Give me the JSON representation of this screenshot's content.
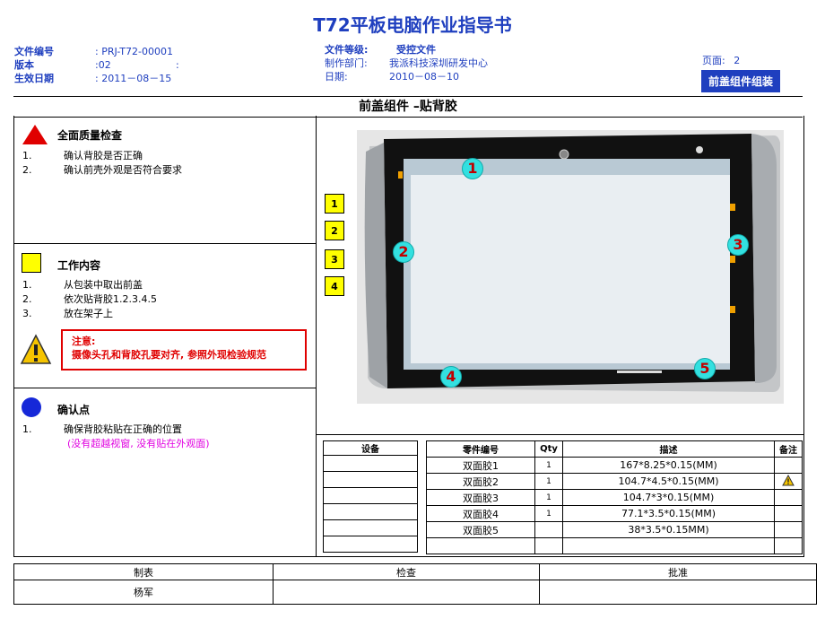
{
  "title": "T72平板电脑作业指导书",
  "header_left": {
    "doc_no_label": "文件编号",
    "doc_no_value": ": PRJ-T72-00001",
    "version_label": "版本",
    "version_value": ":02",
    "colon_extra": ":",
    "effective_label": "生效日期",
    "effective_value": ": 2011－08－15"
  },
  "header_mid": {
    "level_label": "文件等级:",
    "level_value": "受控文件",
    "dept_label": "制作部门:",
    "dept_value": "我派科技深圳研发中心",
    "date_label": "日期:",
    "date_value": "2010－08－10"
  },
  "header_right": {
    "page_label": "页面:",
    "page_value": "2",
    "section_badge": "前盖组件组装"
  },
  "section_title": "前盖组件 –贴背胶",
  "quality": {
    "title": "全面质量检查",
    "items": [
      {
        "num": "1.",
        "text": "确认背胶是否正确"
      },
      {
        "num": "2.",
        "text": "确认前壳外观是否符合要求"
      }
    ]
  },
  "work": {
    "title": "工作内容",
    "items": [
      {
        "num": "1.",
        "text": "从包装中取出前盖"
      },
      {
        "num": "2.",
        "text": "依次贴背胶1.2.3.4.5"
      },
      {
        "num": "3.",
        "text": "放在架子上"
      }
    ],
    "notice_title": "注意:",
    "notice_text": "摄像头孔和背胶孔要对齐, 参照外现检验规范"
  },
  "confirm": {
    "title": "确认点",
    "item_num": "1.",
    "item_text": "确保背胶粘贴在正确的位置",
    "sub_text": "(没有超越视窗, 没有贴在外观面)"
  },
  "step_boxes": [
    "1",
    "2",
    "3",
    "4"
  ],
  "callouts": [
    "1",
    "2",
    "3",
    "4",
    "5"
  ],
  "equipment_header": "设备",
  "parts": {
    "headers": [
      "零件编号",
      "Qty",
      "描述",
      "备注"
    ],
    "rows": [
      {
        "part": "双面胶1",
        "qty": "1",
        "desc": "167*8.25*0.15(MM)",
        "note": ""
      },
      {
        "part": "双面胶2",
        "qty": "1",
        "desc": "104.7*4.5*0.15(MM)",
        "note": "warning-icon"
      },
      {
        "part": "双面胶3",
        "qty": "1",
        "desc": "104.7*3*0.15(MM)",
        "note": ""
      },
      {
        "part": "双面胶4",
        "qty": "1",
        "desc": "77.1*3.5*0.15(MM)",
        "note": ""
      },
      {
        "part": "双面胶5",
        "qty": "",
        "desc": "38*3.5*0.15MM)",
        "note": ""
      }
    ]
  },
  "signoff": {
    "made_label": "制表",
    "check_label": "检查",
    "approve_label": "批准",
    "made_by": "杨军"
  },
  "colors": {
    "accent": "#1f3fbf",
    "warning": "#e00000",
    "note": "#e000e0"
  }
}
